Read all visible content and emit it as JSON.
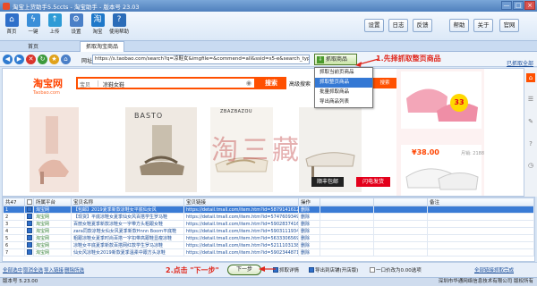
{
  "window": {
    "title": "淘宝上货助手5.5ccts - 淘宝助手 - 版本号 23.03",
    "buttons": [
      "—",
      "□",
      "×"
    ]
  },
  "ribbon": {
    "items": [
      {
        "label": "首页",
        "icon": "home-icon",
        "color": "#2f6fc9"
      },
      {
        "label": "一键",
        "icon": "lightning-icon",
        "color": "#3a8ed8"
      },
      {
        "label": "上传",
        "icon": "upload-icon",
        "color": "#2e9bd6"
      },
      {
        "label": "设置",
        "icon": "gear-icon",
        "color": "#4a7fc7"
      },
      {
        "label": "淘宝",
        "icon": "taobao-icon",
        "color": "#1f78c9"
      },
      {
        "label": "使用帮助",
        "icon": "help-icon",
        "color": "#2b6cb8"
      }
    ],
    "right_buttons": [
      "设置",
      "日志",
      "反馈",
      "帮助",
      "关于",
      "官网"
    ]
  },
  "tabs": {
    "home": "首页",
    "active": "抓取淘宝商品"
  },
  "navbar": {
    "url_label": "网址",
    "url": "https://s.taobao.com/search?q=凉鞋女&imgfile=&commend=all&ssid=s5-e&search_type=item&sourceId=tb.index&spm=a21bo.2017.201867-links-1.5.5af911d9jBg8Q8",
    "grab_button": "抓取商品",
    "annotation1": "1.先择抓取整页商品",
    "top_right": "已抓取全部"
  },
  "dropdown": {
    "items": [
      "抓取当前页商品",
      "抓取整页商品",
      "批量抓取商品",
      "导出商品列表"
    ],
    "selected_index": 1
  },
  "taobao": {
    "logo": "淘宝网",
    "logo_sub": "Taobao.com",
    "search_category": "宝贝",
    "search_query": "凉鞋女鞋",
    "search_button": "搜索",
    "link_text": "高级搜索",
    "mini_button": "搜索",
    "basto": "BASTO",
    "zhuangbrand": "ZBAZBAZOU",
    "watermark": "淘三藏",
    "price": "¥38.00",
    "sold": "月销: 2188",
    "sticker": "33",
    "tag_free": "顺丰包邮",
    "tag_flash": "闪电发货"
  },
  "grid": {
    "headers": [
      "序号",
      "",
      "所属平台",
      "宝贝名称",
      "宝贝链接",
      "操作",
      "",
      "",
      "备注"
    ],
    "total_label": "共47",
    "rows": [
      {
        "n": "1",
        "checked": true,
        "platform": "淘宝网",
        "name": "【包邮】2019夏季新款凉鞋女平底仙女风",
        "link": "https://detail.tmall.com/item.htm?id=58791416126",
        "op": "删除",
        "selected": true
      },
      {
        "n": "2",
        "checked": true,
        "platform": "淘宝网",
        "name": "【现货】平底凉鞋女夏季仙女风百搭学生罗马鞋",
        "link": "https://detail.tmall.com/item.htm?id=57476093497",
        "op": "删除",
        "selected": false
      },
      {
        "n": "3",
        "checked": true,
        "platform": "淘宝网",
        "name": "百丽女鞋夏季新款凉鞋女一字带方头粗跟女鞋",
        "link": "https://detail.tmall.com/item.htm?id=59028374166",
        "op": "删除",
        "selected": false
      },
      {
        "n": "4",
        "checked": true,
        "platform": "淘宝网",
        "name": "zara同款凉鞋女仙女风夏季新款Hnnn Boom平底鞋",
        "link": "https://detail.tmall.com/item.htm?id=59031119347",
        "op": "删除",
        "selected": false
      },
      {
        "n": "5",
        "checked": true,
        "platform": "淘宝网",
        "name": "粗跟凉鞋女夏季时尚百搭一字扣带高跟鞋显瘦凉鞋",
        "link": "https://detail.tmall.com/item.htm?id=56333065697",
        "op": "删除",
        "selected": false
      },
      {
        "n": "6",
        "checked": true,
        "platform": "淘宝网",
        "name": "凉鞋女平底夏季新款百搭网红款学生罗马凉鞋",
        "link": "https://detail.tmall.com/item.htm?id=52111031386",
        "op": "删除",
        "selected": false
      },
      {
        "n": "7",
        "checked": true,
        "platform": "淘宝网",
        "name": "仙女风凉鞋女2019新款夏季温柔中跟方头凉鞋",
        "link": "https://detail.tmall.com/item.htm?id=59023448715",
        "op": "删除",
        "selected": false
      }
    ]
  },
  "bottom": {
    "links": [
      "全部选中",
      "取消全选",
      "导入链接",
      "删除所选"
    ],
    "annotation2": "2.点击 \"下一步\"",
    "next_button": "下一步",
    "opt1": "抓取详情",
    "opt2": "导出到店铺(开店版)",
    "opt3": "一口价改为0.00选项",
    "opt_under": "开店助理",
    "right_link": "全部链接抓取完成"
  },
  "status": {
    "left": "版本号 5.23.00",
    "right": "深圳市华通网络信息技术有限公司 版权所有"
  },
  "colors": {
    "taobao_orange": "#ff5000",
    "annotation_red": "#e0261b",
    "selection_blue": "#3a7bd5"
  }
}
